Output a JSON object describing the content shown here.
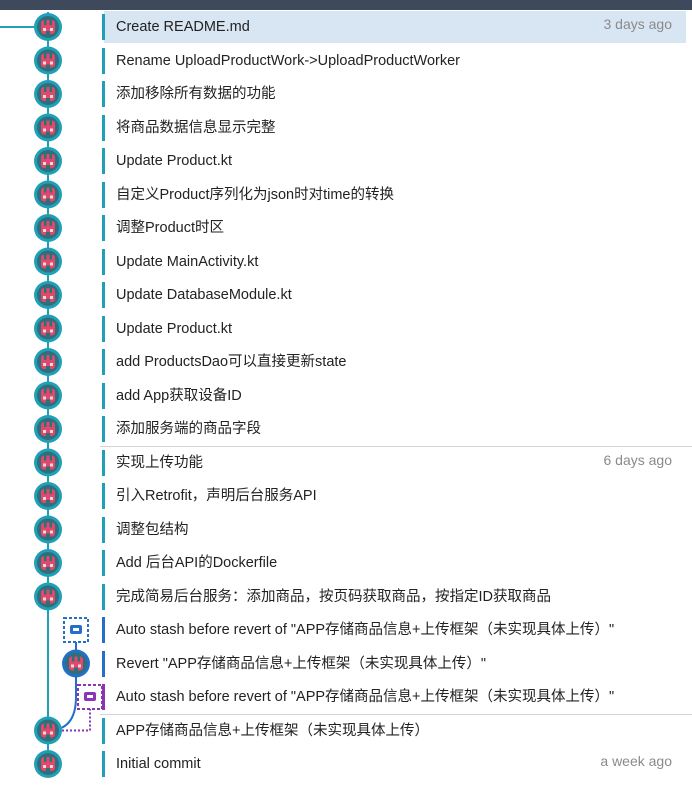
{
  "colors": {
    "branch_line": "#20a0b8",
    "stash_blue": "#2470c8",
    "stash_purple": "#8a34b8",
    "avatar_ring_teal": "#20a0b8",
    "avatar_ring_blue": "#2470c8",
    "avatar_face": "#e0486c",
    "avatar_bg": "#2f6f7a"
  },
  "commits": [
    {
      "message": "Create README.md",
      "date": "3 days ago",
      "kind": "commit",
      "selected": true
    },
    {
      "message": "Rename UploadProductWork->UploadProductWorker",
      "date": "",
      "kind": "commit"
    },
    {
      "message": "添加移除所有数据的功能",
      "date": "",
      "kind": "commit"
    },
    {
      "message": "将商品数据信息显示完整",
      "date": "",
      "kind": "commit"
    },
    {
      "message": "Update Product.kt",
      "date": "",
      "kind": "commit"
    },
    {
      "message": "自定义Product序列化为json时对time的转换",
      "date": "",
      "kind": "commit"
    },
    {
      "message": "调整Product时区",
      "date": "",
      "kind": "commit"
    },
    {
      "message": "Update MainActivity.kt",
      "date": "",
      "kind": "commit"
    },
    {
      "message": "Update DatabaseModule.kt",
      "date": "",
      "kind": "commit"
    },
    {
      "message": "Update Product.kt",
      "date": "",
      "kind": "commit"
    },
    {
      "message": "add ProductsDao可以直接更新state",
      "date": "",
      "kind": "commit"
    },
    {
      "message": "add App获取设备ID",
      "date": "",
      "kind": "commit"
    },
    {
      "message": "添加服务端的商品字段",
      "date": "",
      "kind": "commit"
    },
    {
      "message": "实现上传功能",
      "date": "6 days ago",
      "kind": "commit"
    },
    {
      "message": "引入Retrofit，声明后台服务API",
      "date": "",
      "kind": "commit"
    },
    {
      "message": "调整包结构",
      "date": "",
      "kind": "commit"
    },
    {
      "message": "Add 后台API的Dockerfile",
      "date": "",
      "kind": "commit"
    },
    {
      "message": "完成简易后台服务：添加商品，按页码获取商品，按指定ID获取商品",
      "date": "",
      "kind": "commit"
    },
    {
      "message": "Auto stash before revert of \"APP存储商品信息+上传框架（未实现具体上传）\"",
      "date": "",
      "kind": "stash-blue"
    },
    {
      "message": "Revert \"APP存储商品信息+上传框架（未实现具体上传）\"",
      "date": "",
      "kind": "commit-blue"
    },
    {
      "message": "Auto stash before revert of \"APP存储商品信息+上传框架（未实现具体上传）\"",
      "date": "",
      "kind": "stash-purple"
    },
    {
      "message": "APP存储商品信息+上传框架（未实现具体上传）",
      "date": "",
      "kind": "commit"
    },
    {
      "message": "Initial commit",
      "date": "a week ago",
      "kind": "commit"
    }
  ]
}
